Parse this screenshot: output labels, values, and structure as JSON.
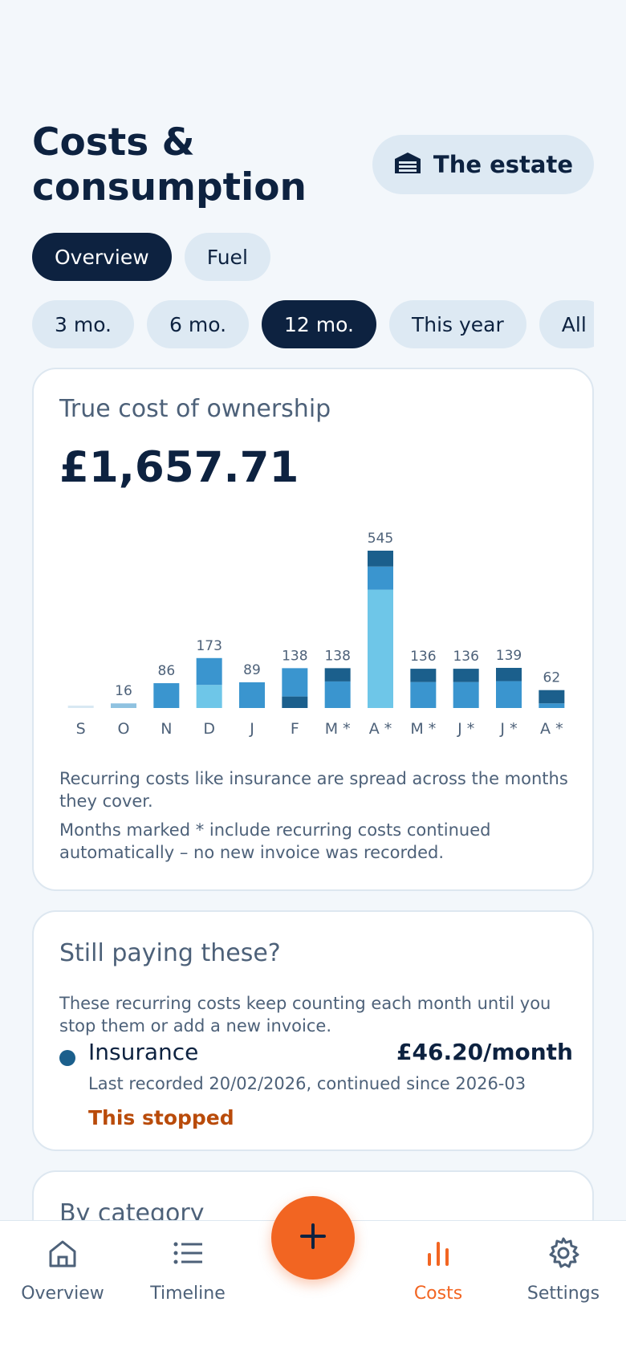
{
  "header": {
    "title_line1": "Costs &",
    "title_line2": "consumption",
    "vehicle": "The estate",
    "vehicle_icon": "garage-icon"
  },
  "tabs": [
    {
      "label": "Overview",
      "active": true
    },
    {
      "label": "Fuel",
      "active": false
    }
  ],
  "ranges": [
    {
      "label": "3 mo.",
      "active": false
    },
    {
      "label": "6 mo.",
      "active": false
    },
    {
      "label": "12 mo.",
      "active": true
    },
    {
      "label": "This year",
      "active": false
    },
    {
      "label": "All",
      "active": false
    }
  ],
  "cost_card": {
    "heading": "True cost of ownership",
    "total": "£1,657.71",
    "note1": "Recurring costs like insurance are spread across the months they cover.",
    "note2": "Months marked * include recurring costs continued automatically – no new invoice was recorded."
  },
  "chart_data": {
    "type": "bar",
    "stacked": true,
    "categories": [
      "S",
      "O",
      "N",
      "D",
      "J",
      "F",
      "M *",
      "A *",
      "M *",
      "J *",
      "J *",
      "A *"
    ],
    "values": [
      5,
      16,
      86,
      173,
      89,
      138,
      138,
      545,
      136,
      136,
      139,
      62
    ],
    "value_labels": [
      "",
      "16",
      "86",
      "173",
      "89",
      "138",
      "138",
      "545",
      "136",
      "136",
      "139",
      "62"
    ],
    "segments": [
      [
        {
          "v": 5,
          "c": "#d8e8f3"
        }
      ],
      [
        {
          "v": 16,
          "c": "#8fc2e0"
        }
      ],
      [
        {
          "v": 86,
          "c": "#3a95cf"
        }
      ],
      [
        {
          "v": 80,
          "c": "#6ec6e8"
        },
        {
          "v": 93,
          "c": "#3a95cf"
        }
      ],
      [
        {
          "v": 89,
          "c": "#3a95cf"
        }
      ],
      [
        {
          "v": 40,
          "c": "#1b5f8c"
        },
        {
          "v": 98,
          "c": "#3a95cf"
        }
      ],
      [
        {
          "v": 92,
          "c": "#3a95cf"
        },
        {
          "v": 46,
          "c": "#1b5f8c"
        }
      ],
      [
        {
          "v": 410,
          "c": "#6ec6e8"
        },
        {
          "v": 80,
          "c": "#3a95cf"
        },
        {
          "v": 55,
          "c": "#1b5f8c"
        }
      ],
      [
        {
          "v": 90,
          "c": "#3a95cf"
        },
        {
          "v": 46,
          "c": "#1b5f8c"
        }
      ],
      [
        {
          "v": 90,
          "c": "#3a95cf"
        },
        {
          "v": 46,
          "c": "#1b5f8c"
        }
      ],
      [
        {
          "v": 93,
          "c": "#3a95cf"
        },
        {
          "v": 46,
          "c": "#1b5f8c"
        }
      ],
      [
        {
          "v": 16,
          "c": "#3a95cf"
        },
        {
          "v": 46,
          "c": "#1b5f8c"
        }
      ]
    ],
    "ylim": [
      0,
      545
    ],
    "title": "",
    "xlabel": "",
    "ylabel": "",
    "grid": false
  },
  "recurring": {
    "heading": "Still paying these?",
    "description": "These recurring costs keep counting each month until you stop them or add a new invoice.",
    "items": [
      {
        "name": "Insurance",
        "amount": "£46.20/month",
        "meta": "Last recorded 20/02/2026, continued since 2026-03",
        "action": "This stopped"
      }
    ]
  },
  "category": {
    "heading": "By category"
  },
  "nav": {
    "items": [
      {
        "label": "Overview",
        "icon": "home-icon",
        "active": false
      },
      {
        "label": "Timeline",
        "icon": "list-icon",
        "active": false
      },
      {
        "label": "Costs",
        "icon": "bar-chart-icon",
        "active": true
      },
      {
        "label": "Settings",
        "icon": "gear-icon",
        "active": false
      }
    ],
    "fab_icon": "plus-icon"
  },
  "colors": {
    "navy": "#0d2240",
    "accent": "#f26522",
    "warning_text": "#b94b0a"
  }
}
